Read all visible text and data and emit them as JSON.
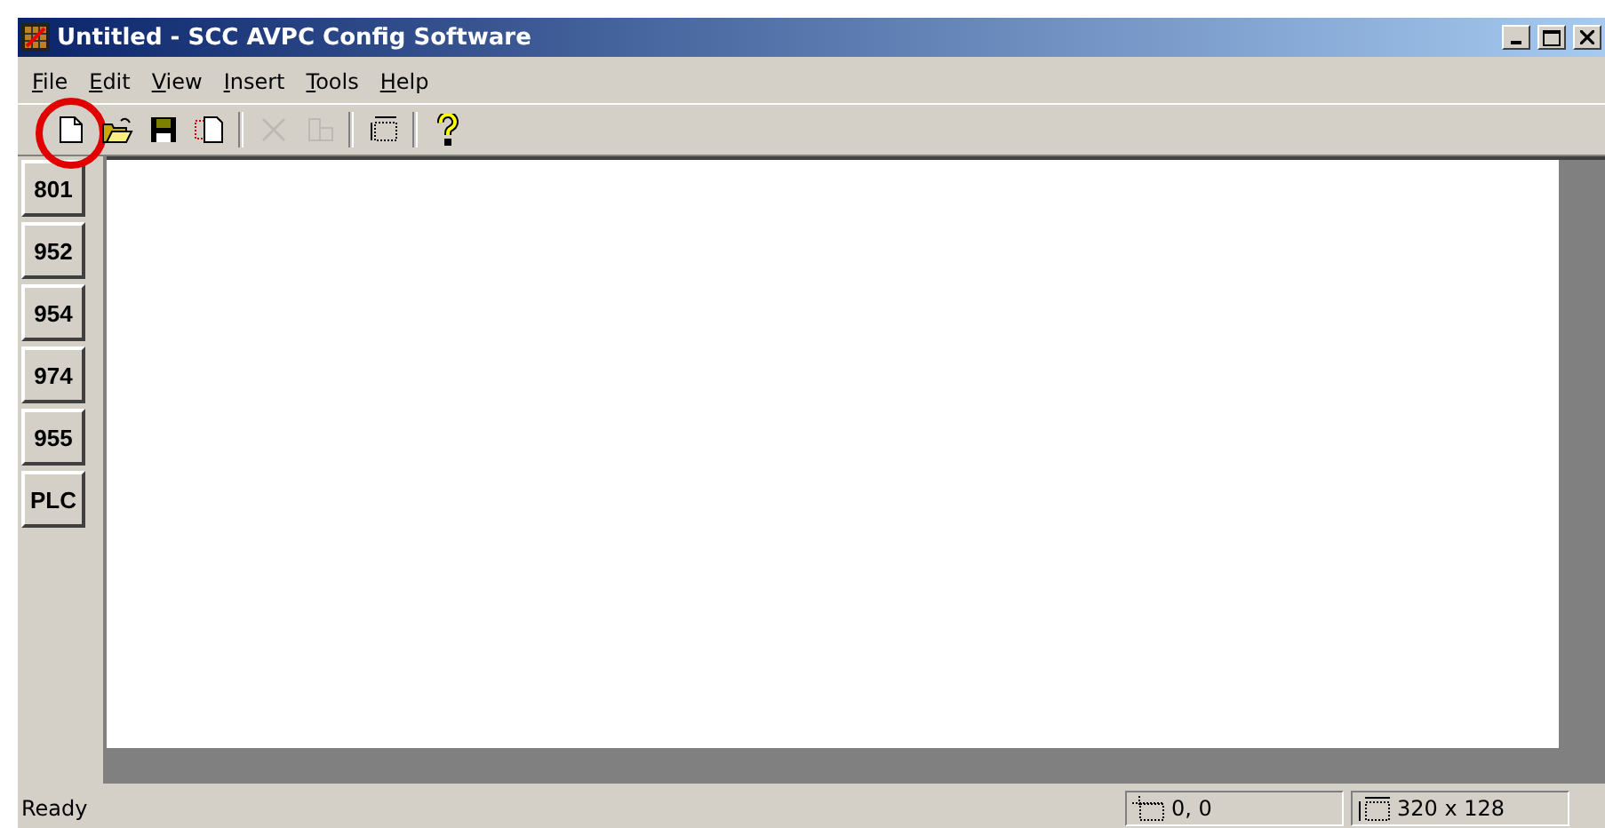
{
  "window": {
    "title": "Untitled - SCC AVPC Config Software"
  },
  "menu": [
    {
      "label": "File"
    },
    {
      "label": "Edit"
    },
    {
      "label": "View"
    },
    {
      "label": "Insert"
    },
    {
      "label": "Tools"
    },
    {
      "label": "Help"
    }
  ],
  "toolbar": [
    {
      "kind": "new",
      "disabled": false,
      "highlighted": true
    },
    {
      "kind": "open",
      "disabled": false,
      "highlighted": false
    },
    {
      "kind": "save",
      "disabled": false,
      "highlighted": false
    },
    {
      "kind": "copy",
      "disabled": false,
      "highlighted": false
    },
    {
      "kind": "separator"
    },
    {
      "kind": "delete",
      "disabled": true,
      "highlighted": false
    },
    {
      "kind": "properties",
      "disabled": true,
      "highlighted": false
    },
    {
      "kind": "separator"
    },
    {
      "kind": "size",
      "disabled": false,
      "highlighted": false
    },
    {
      "kind": "separator"
    },
    {
      "kind": "help",
      "disabled": false,
      "highlighted": false
    }
  ],
  "devices": [
    "801",
    "952",
    "954",
    "974",
    "955",
    "PLC"
  ],
  "status_bar": {
    "message": "Ready",
    "position": "0, 0",
    "size": "320 x 128"
  }
}
